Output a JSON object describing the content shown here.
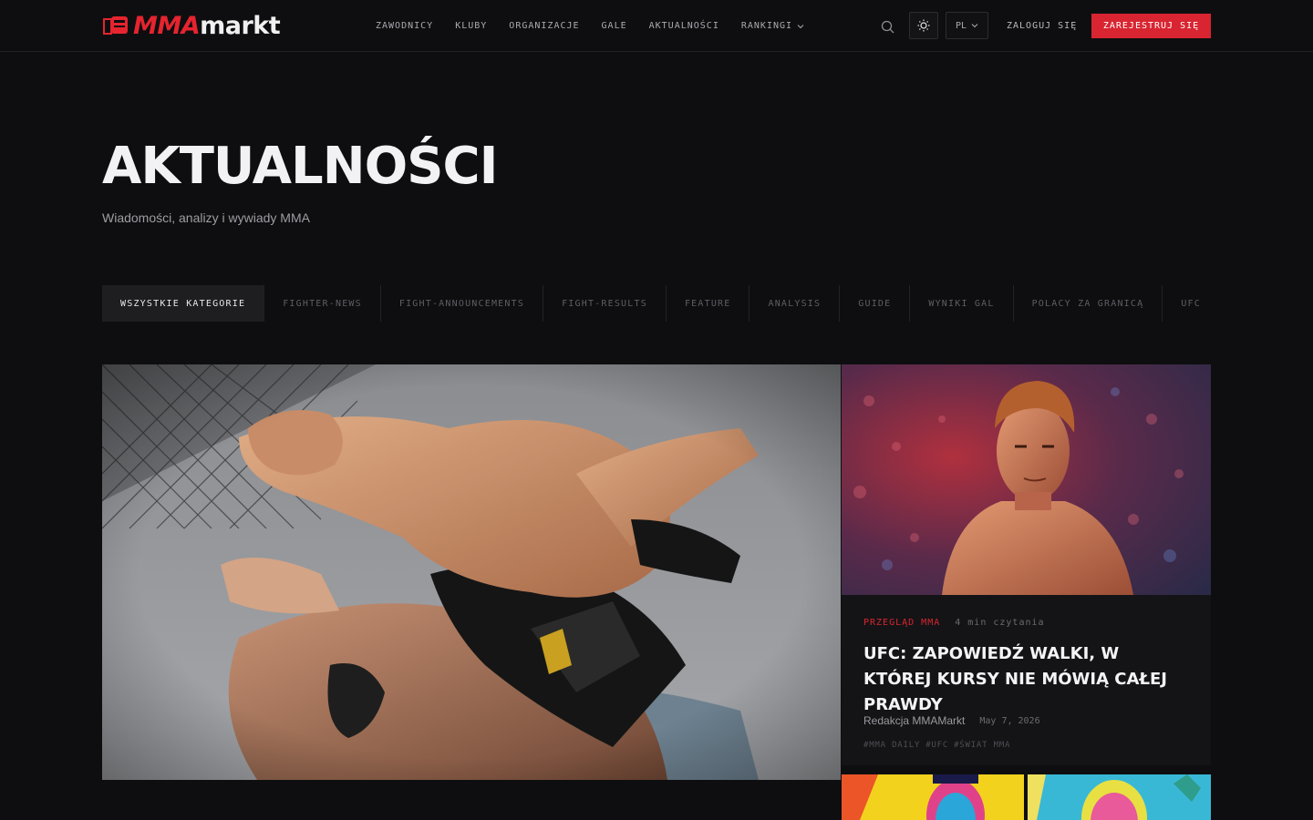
{
  "brand": {
    "logo_mma": "MMA",
    "logo_markt": "markt"
  },
  "nav": {
    "items": [
      {
        "label": "ZAWODNICY"
      },
      {
        "label": "KLUBY"
      },
      {
        "label": "ORGANIZACJE"
      },
      {
        "label": "GALE"
      },
      {
        "label": "AKTUALNOŚCI"
      },
      {
        "label": "RANKINGI"
      }
    ]
  },
  "header": {
    "search_icon": "search-icon",
    "theme_icon": "sun-icon",
    "language": "PL",
    "login_label": "ZALOGUJ SIĘ",
    "register_label": "ZAREJESTRUJ SIĘ"
  },
  "hero": {
    "title": "AKTUALNOŚCI",
    "subtitle": "Wiadomości, analizy i wywiady MMA"
  },
  "tabs": [
    {
      "label": "WSZYSTKIE KATEGORIE",
      "active": true
    },
    {
      "label": "FIGHTER-NEWS"
    },
    {
      "label": "FIGHT-ANNOUNCEMENTS"
    },
    {
      "label": "FIGHT-RESULTS"
    },
    {
      "label": "FEATURE"
    },
    {
      "label": "ANALYSIS"
    },
    {
      "label": "GUIDE"
    },
    {
      "label": "WYNIKI GAL"
    },
    {
      "label": "POLACY ZA GRANICĄ"
    },
    {
      "label": "UFC"
    }
  ],
  "side_article": {
    "category": "PRZEGLĄD MMA",
    "read_time": "4 min czytania",
    "title": "UFC: ZAPOWIEDŹ WALKI, W KTÓREJ KURSY NIE MÓWIĄ CAŁEJ PRAWDY",
    "author": "Redakcja MMAMarkt",
    "date": "May 7, 2026",
    "tags": [
      "#MMA DAILY",
      "#UFC",
      "#ŚWIAT MMA"
    ]
  },
  "colors": {
    "accent": "#d82531",
    "background": "#0e0e10",
    "surface": "#141416"
  }
}
